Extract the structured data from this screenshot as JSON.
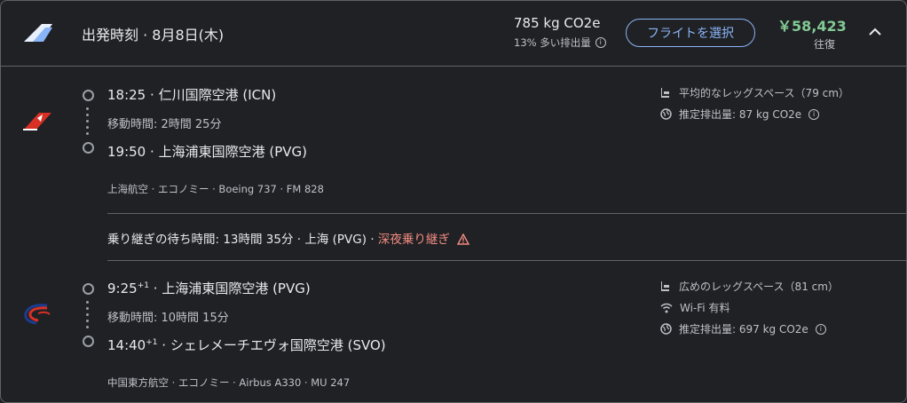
{
  "header": {
    "title": "出発時刻 · 8月8日(木)",
    "co2": "785 kg CO2e",
    "co2_sub": "13% 多い排出量",
    "select_label": "フライトを選択",
    "price": "￥58,423",
    "trip_type": "往復"
  },
  "segments": [
    {
      "dep_time": "18:25",
      "dep_sup": "",
      "dep_airport": "仁川国際空港 (ICN)",
      "duration": "移動時間: 2時間 25分",
      "arr_time": "19:50",
      "arr_sup": "",
      "arr_airport": "上海浦東国際空港 (PVG)",
      "details": "上海航空 · エコノミー · Boeing 737 · FM 828",
      "amenities": {
        "legroom": "平均的なレッグスペース（79 cm）",
        "emissions": "推定排出量: 87 kg CO2e"
      },
      "airline_color": "#d93025"
    },
    {
      "dep_time": "9:25",
      "dep_sup": "+1",
      "dep_airport": "上海浦東国際空港 (PVG)",
      "duration": "移動時間: 10時間 15分",
      "arr_time": "14:40",
      "arr_sup": "+1",
      "arr_airport": "シェレメーチエヴォ国際空港 (SVO)",
      "details": "中国東方航空 · エコノミー · Airbus A330 · MU 247",
      "amenities": {
        "legroom": "広めのレッグスペース（81 cm）",
        "wifi": "Wi-Fi 有料",
        "emissions": "推定排出量: 697 kg CO2e"
      },
      "airline_color": "#1a3d8f"
    }
  ],
  "layover": {
    "text": "乗り継ぎの待ち時間: 13時間 35分 · 上海 (PVG) · ",
    "warning": "深夜乗り継ぎ"
  },
  "separator": "·",
  "icons": {
    "header_logo": "airline-tail-logo-icon",
    "chevron": "chevron-up-icon",
    "info": "info-icon",
    "legroom": "seat-icon",
    "wifi": "wifi-icon",
    "emissions": "globe-icon",
    "warning": "warning-icon"
  }
}
